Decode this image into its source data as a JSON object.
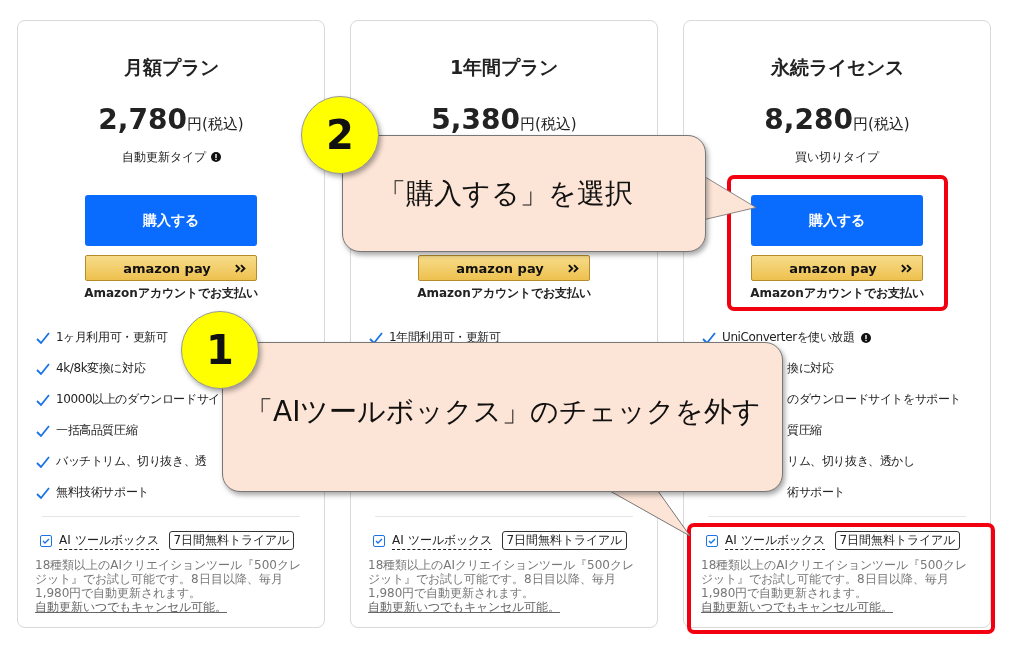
{
  "plans": [
    {
      "title": "月額プラン",
      "price": "2,780",
      "price_suffix": "円(税込)",
      "subtitle": {
        "text": "自動更新タイプ",
        "info": true
      },
      "buy_button": "購入する",
      "amazon_pay": {
        "logo": "amazon pay",
        "caption": "Amazonアカウントでお支払い"
      },
      "features": [
        {
          "kind": "full",
          "text": "1ヶ月利用可・更新可",
          "info": false
        },
        {
          "kind": "full",
          "text": "4k/8k変換に対応",
          "info": false
        },
        {
          "kind": "full",
          "text": "10000以上のダウンロードサイ",
          "info": false
        },
        {
          "kind": "full",
          "text": "一括高品質圧縮",
          "info": false
        },
        {
          "kind": "full",
          "text": "バッチトリム、切り抜き、透",
          "info": false
        },
        {
          "kind": "full",
          "text": "無料技術サポート",
          "info": false
        }
      ],
      "addon": {
        "label": "AI ツールボックス",
        "checked": true,
        "badge": "7日間無料トライアル",
        "description": "18種類以上のAIクリエイションツール『500クレジット』でお試し可能です。8日目以降、毎月 1,980円で自動更新されます。",
        "link": "自動更新いつでもキャンセル可能。"
      }
    },
    {
      "title": "1年間プラン",
      "price": "5,380",
      "price_suffix": "円(税込)",
      "amazon_pay": {
        "logo": "amazon pay",
        "caption": "Amazonアカウントでお支払い"
      },
      "features": [
        {
          "kind": "full",
          "text": "1年間利用可・更新可",
          "info": false
        }
      ],
      "addon": {
        "label": "AI ツールボックス",
        "checked": true,
        "badge": "7日間無料トライアル",
        "description": "18種類以上のAIクリエイションツール『500クレジット』でお試し可能です。8日目以降、毎月 1,980円で自動更新されます。",
        "link": "自動更新いつでもキャンセル可能。"
      }
    },
    {
      "title": "永続ライセンス",
      "price": "8,280",
      "price_suffix": "円(税込)",
      "subtitle": {
        "text": "買い切りタイプ",
        "info": false
      },
      "buy_button": "購入する",
      "amazon_pay": {
        "logo": "amazon pay",
        "caption": "Amazonアカウントでお支払い"
      },
      "features": [
        {
          "kind": "full",
          "text": "UniConverterを使い放題",
          "info": true
        },
        {
          "kind": "partial",
          "text": "換に対応",
          "info": false
        },
        {
          "kind": "partial",
          "text": "のダウンロードサイトをサポート",
          "info": false
        },
        {
          "kind": "partial",
          "text": "質圧縮",
          "info": false
        },
        {
          "kind": "partial",
          "text": "リム、切り抜き、透かし",
          "info": false
        },
        {
          "kind": "partial",
          "text": "術サポート",
          "info": false
        }
      ],
      "addon": {
        "label": "AI ツールボックス",
        "checked": true,
        "badge": "7日間無料トライアル",
        "description": "18種類以上のAIクリエイションツール『500クレジット』でお試し可能です。8日目以降、毎月 1,980円で自動更新されます。",
        "link": "自動更新いつでもキャンセル可能。"
      }
    }
  ],
  "annotations": [
    {
      "number": "2",
      "text": "「購入する」を選択"
    },
    {
      "number": "1",
      "text": "「AIツールボックス」のチェックを外す"
    }
  ]
}
